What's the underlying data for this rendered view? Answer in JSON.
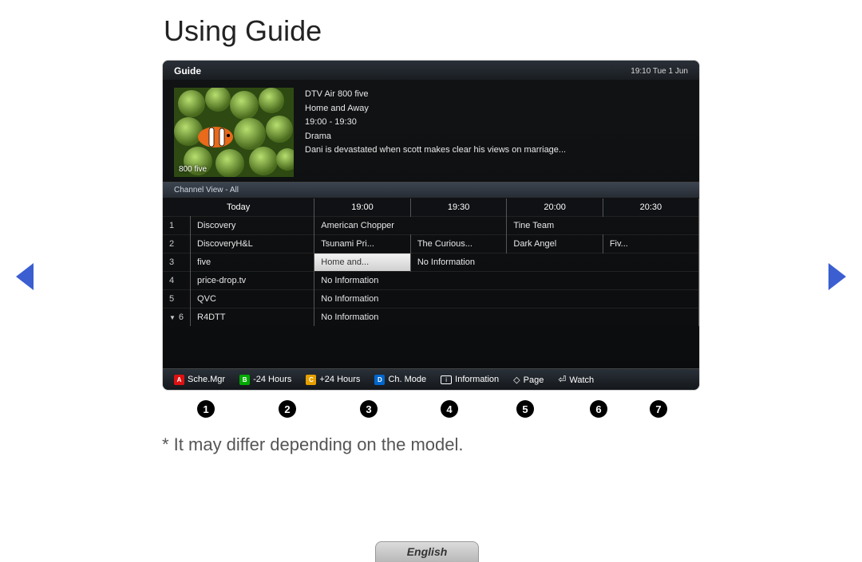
{
  "page": {
    "title": "Using Guide",
    "footnote": "* It may differ depending on the model.",
    "language": "English"
  },
  "guide": {
    "header_title": "Guide",
    "datetime": "19:10 Tue 1 Jun",
    "preview": {
      "thumb_caption": "800 five",
      "channel": "DTV Air 800 five",
      "programme": "Home and Away",
      "time": "19:00 - 19:30",
      "genre": "Drama",
      "description": "Dani is devastated when scott makes clear his views on marriage..."
    },
    "channel_view_label": "Channel View - All",
    "time_header": {
      "today_label": "Today",
      "slots": [
        "19:00",
        "19:30",
        "20:00",
        "20:30"
      ]
    },
    "rows": [
      {
        "num": "1",
        "name": "Discovery",
        "cells": [
          {
            "text": "American Chopper",
            "span": 2
          },
          {
            "text": "Tine Team",
            "span": 2
          }
        ]
      },
      {
        "num": "2",
        "name": "DiscoveryH&L",
        "cells": [
          {
            "text": "Tsunami Pri...",
            "span": 1
          },
          {
            "text": "The Curious...",
            "span": 1
          },
          {
            "text": "Dark Angel",
            "span": 1
          },
          {
            "text": "Fiv...",
            "span": 1
          }
        ]
      },
      {
        "num": "3",
        "name": "five",
        "cells": [
          {
            "text": "Home and...",
            "span": 1,
            "highlight": true
          },
          {
            "text": "No Information",
            "span": 3
          }
        ]
      },
      {
        "num": "4",
        "name": "price-drop.tv",
        "cells": [
          {
            "text": "No Information",
            "span": 4
          }
        ]
      },
      {
        "num": "5",
        "name": "QVC",
        "cells": [
          {
            "text": "No Information",
            "span": 4
          }
        ]
      },
      {
        "num": "6",
        "name": "R4DTT",
        "down": true,
        "cells": [
          {
            "text": "No Information",
            "span": 4
          }
        ]
      }
    ],
    "legend": {
      "a": "Sche.Mgr",
      "b": "-24 Hours",
      "c": "+24 Hours",
      "d": "Ch. Mode",
      "info": "Information",
      "page": "Page",
      "watch": "Watch"
    }
  },
  "callouts": [
    "1",
    "2",
    "3",
    "4",
    "5",
    "6",
    "7"
  ]
}
